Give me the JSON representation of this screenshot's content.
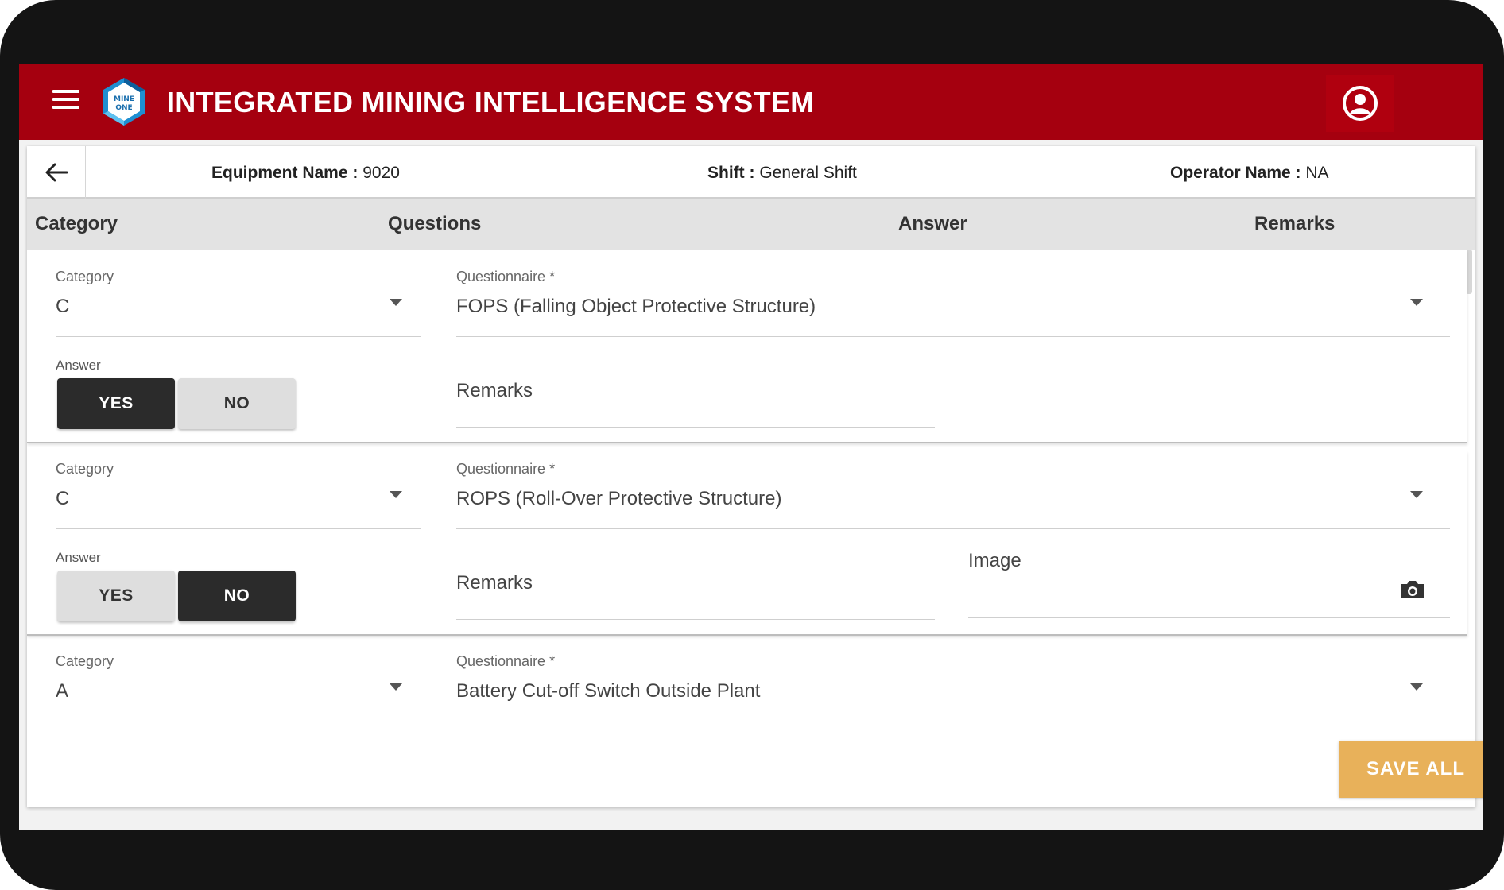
{
  "app": {
    "title": "INTEGRATED MINING INTELLIGENCE SYSTEM",
    "logo_text_top": "MINE",
    "logo_text_bottom": "ONE",
    "brand_color": "#a5000f",
    "icons": {
      "menu": "hamburger-menu-icon",
      "account": "account-circle-icon",
      "back": "arrow-left-icon",
      "camera": "camera-icon",
      "dropdown": "triangle-down-icon"
    }
  },
  "info": {
    "equipment_label": "Equipment Name :",
    "equipment_value": "9020",
    "shift_label": "Shift :",
    "shift_value": "General Shift",
    "operator_label": "Operator Name :",
    "operator_value": "NA"
  },
  "table": {
    "headers": [
      "Category",
      "Questions",
      "Answer",
      "Remarks"
    ]
  },
  "rows": [
    {
      "category_label": "Category",
      "category_value": "C",
      "question_label": "Questionnaire *",
      "question_value": "FOPS (Falling Object Protective Structure)",
      "answer_label": "Answer",
      "yes_label": "YES",
      "no_label": "NO",
      "selected": "YES",
      "remarks_placeholder": "Remarks"
    },
    {
      "category_label": "Category",
      "category_value": "C",
      "question_label": "Questionnaire *",
      "question_value": "ROPS (Roll-Over Protective Structure)",
      "answer_label": "Answer",
      "yes_label": "YES",
      "no_label": "NO",
      "selected": "NO",
      "remarks_placeholder": "Remarks",
      "image_label": "Image"
    },
    {
      "category_label": "Category",
      "category_value": "A",
      "question_label": "Questionnaire *",
      "question_value": "Battery Cut-off Switch Outside Plant"
    }
  ],
  "actions": {
    "save_all": "SAVE ALL",
    "save_color": "#e8b15a"
  }
}
